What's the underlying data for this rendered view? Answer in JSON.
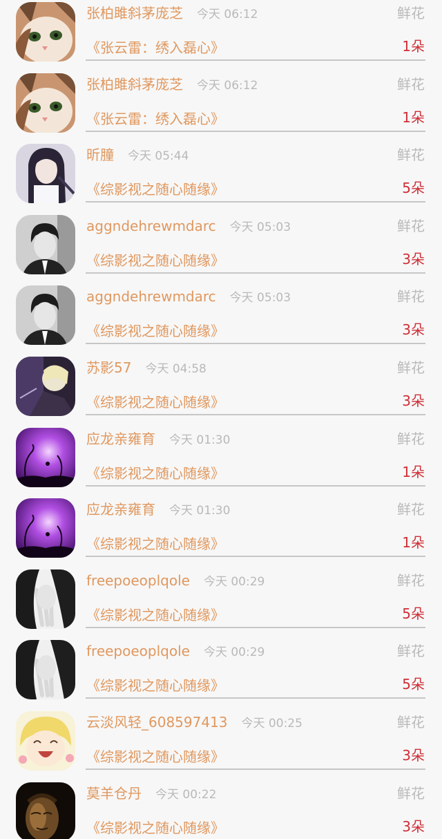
{
  "gift_label": "鲜花",
  "records": [
    {
      "user": "张柏雎斜茅庞芝",
      "time": "今天 06:12",
      "book": "《张云雷：绣入磊心》",
      "count": "1朵",
      "avatar": "cat"
    },
    {
      "user": "张柏雎斜茅庞芝",
      "time": "今天 06:12",
      "book": "《张云雷：绣入磊心》",
      "count": "1朵",
      "avatar": "cat"
    },
    {
      "user": "昕朣",
      "time": "今天 05:44",
      "book": "《综影视之随心随缘》",
      "count": "5朵",
      "avatar": "anime-girl"
    },
    {
      "user": "aggndehrewmdarc",
      "time": "今天 05:03",
      "book": "《综影视之随心随缘》",
      "count": "3朵",
      "avatar": "man-bw"
    },
    {
      "user": "aggndehrewmdarc",
      "time": "今天 05:03",
      "book": "《综影视之随心随缘》",
      "count": "3朵",
      "avatar": "man-bw"
    },
    {
      "user": "苏影57",
      "time": "今天 04:58",
      "book": "《综影视之随心随缘》",
      "count": "3朵",
      "avatar": "anime-dark"
    },
    {
      "user": "应龙亲雍育",
      "time": "今天 01:30",
      "book": "《综影视之随心随缘》",
      "count": "1朵",
      "avatar": "purple-silhouette"
    },
    {
      "user": "应龙亲雍育",
      "time": "今天 01:30",
      "book": "《综影视之随心随缘》",
      "count": "1朵",
      "avatar": "purple-silhouette"
    },
    {
      "user": "freepoeoplqole",
      "time": "今天 00:29",
      "book": "《综影视之随心随缘》",
      "count": "5朵",
      "avatar": "hands-bw"
    },
    {
      "user": "freepoeoplqole",
      "time": "今天 00:29",
      "book": "《综影视之随心随缘》",
      "count": "5朵",
      "avatar": "hands-bw"
    },
    {
      "user": "云淡风轻_608597413",
      "time": "今天 00:25",
      "book": "《综影视之随心随缘》",
      "count": "3朵",
      "avatar": "anime-laugh"
    },
    {
      "user": "莫羊仓丹",
      "time": "今天 00:22",
      "book": "《综影视之随心随缘》",
      "count": "3朵",
      "avatar": "buddha"
    }
  ]
}
